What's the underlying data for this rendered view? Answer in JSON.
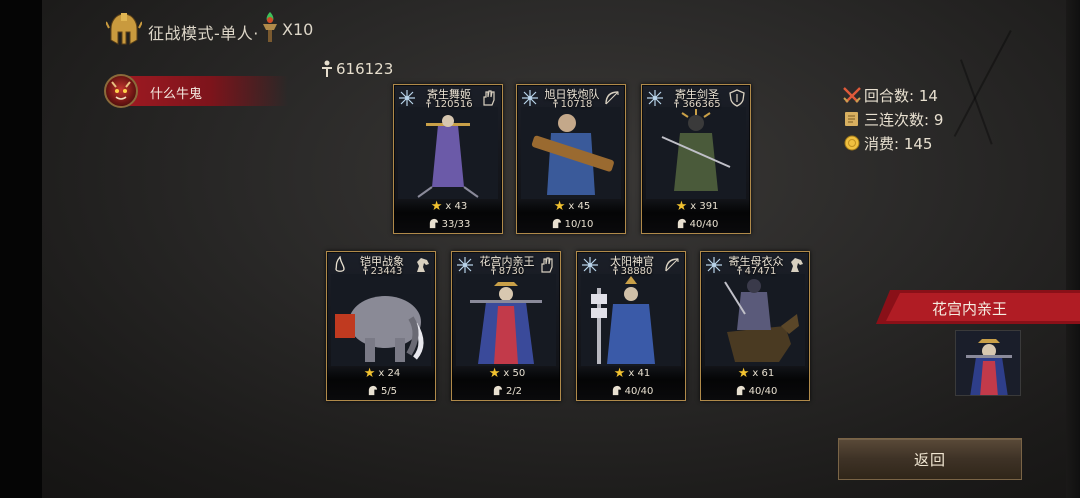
{
  "header": {
    "mode_title": "征战模式-单人·",
    "torch_count": "X10"
  },
  "power_total": "616123",
  "player": {
    "name": "什么牛鬼"
  },
  "stats": {
    "rounds_label": "回合数: 14",
    "combo_label": "三连次数: 9",
    "cost_label": "消费: 145"
  },
  "units": [
    {
      "name": "寄生舞姬",
      "power": "120516",
      "stars": "x 43",
      "troops": "33/33",
      "left_icon": "snowflake-icon",
      "right_icon": "hand-icon",
      "accent": "#6b5aa8"
    },
    {
      "name": "旭日铁炮队",
      "power": "10718",
      "stars": "x 45",
      "troops": "10/10",
      "left_icon": "snowflake-icon",
      "right_icon": "bow-icon",
      "accent": "#3a5a9a"
    },
    {
      "name": "寄生剑圣",
      "power": "366365",
      "stars": "x 391",
      "troops": "40/40",
      "left_icon": "snowflake-icon",
      "right_icon": "shield-icon",
      "accent": "#7a6a4a"
    },
    {
      "name": "铠甲战象",
      "power": "23443",
      "stars": "x 24",
      "troops": "5/5",
      "left_icon": "flame-icon",
      "right_icon": "horse-icon",
      "accent": "#9a9aa6"
    },
    {
      "name": "花宫内亲王",
      "power": "8730",
      "stars": "x 50",
      "troops": "2/2",
      "left_icon": "snowflake-icon",
      "right_icon": "hand-icon",
      "accent": "#3a4a9a"
    },
    {
      "name": "太阳神官",
      "power": "38880",
      "stars": "x 41",
      "troops": "40/40",
      "left_icon": "snowflake-icon",
      "right_icon": "bow-icon",
      "accent": "#3a5aa8"
    },
    {
      "name": "寄生母衣众",
      "power": "47471",
      "stars": "x 61",
      "troops": "40/40",
      "left_icon": "snowflake-icon",
      "right_icon": "horse-icon",
      "accent": "#5a5a7a"
    }
  ],
  "featured": {
    "name": "花宫内亲王"
  },
  "back_label": "返回",
  "colors": {
    "gold": "#b08a4a",
    "red_band": "#a01a22",
    "star": "#f2c230",
    "button": "#3e3226"
  }
}
